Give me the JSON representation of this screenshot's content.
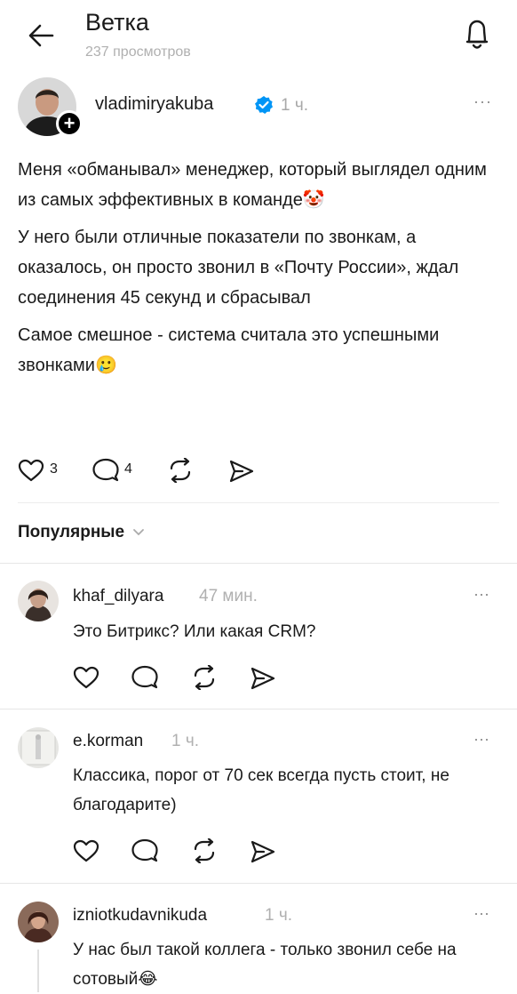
{
  "header": {
    "title": "Ветка",
    "subtitle": "237 просмотров"
  },
  "post": {
    "author": "vladimiryakuba",
    "time": "1 ч.",
    "paragraphs": [
      "Меня «обманывал» менеджер, который выглядел одним из самых эффективных в команде",
      "У него были отличные показатели по звонкам, а оказалось, он просто звонил в «Почту России», ждал соединения 45 секунд и сбрасывал",
      "Самое смешное - система считала это успешными звонками"
    ],
    "emoji_1": "🤡",
    "emoji_2": "🥲",
    "likes": "3",
    "replies": "4"
  },
  "sort": {
    "label": "Популярные"
  },
  "comments": [
    {
      "author": "khaf_dilyara",
      "time": "47 мин.",
      "text": "Это Битрикс? Или какая CRM?"
    },
    {
      "author": "e.korman",
      "time": "1 ч.",
      "text": "Классика, порог от 70 сек всегда пусть стоит, не благодарите)"
    },
    {
      "author": "izniotkudavnikuda",
      "time": "1 ч.",
      "text": "У нас был такой коллега - только звонил себе на сотовый",
      "emoji": "😂"
    }
  ],
  "colors": {
    "verified": "#0095f6",
    "text": "#1a1a1a",
    "muted": "#9a9a9a"
  }
}
